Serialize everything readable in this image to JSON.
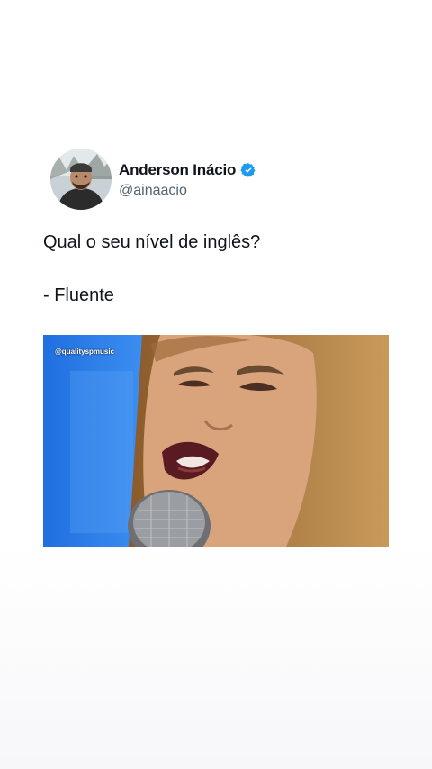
{
  "tweet": {
    "author_name": "Anderson Inácio",
    "author_handle": "@ainaacio",
    "verified_color": "#1d9bf0",
    "text_line_1": "Qual o seu nível de inglês?",
    "text_line_2": "- Fluente",
    "media": {
      "watermark": "@qualityspmusic"
    }
  },
  "icons": {
    "verified": "verified-badge-icon"
  }
}
